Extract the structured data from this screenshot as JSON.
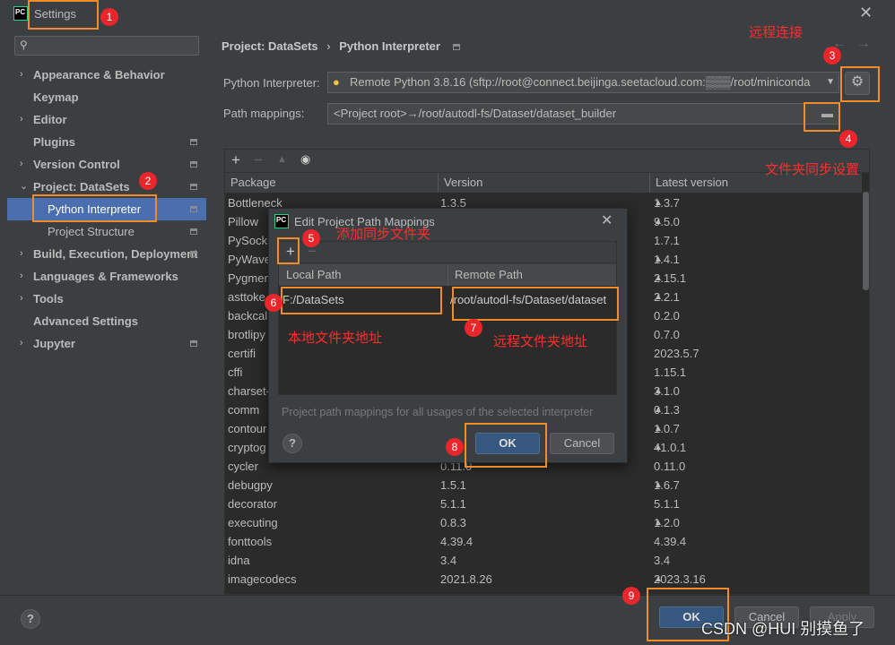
{
  "window": {
    "title": "Settings",
    "logo": "PC"
  },
  "sidebar": {
    "search_placeholder": "",
    "items": [
      {
        "label": "Appearance & Behavior",
        "chevron": "›"
      },
      {
        "label": "Keymap"
      },
      {
        "label": "Editor",
        "chevron": "›"
      },
      {
        "label": "Plugins"
      },
      {
        "label": "Version Control",
        "chevron": "›"
      },
      {
        "label": "Project: DataSets",
        "chevron": "⌄"
      },
      {
        "label": "Python Interpreter"
      },
      {
        "label": "Project Structure"
      },
      {
        "label": "Build, Execution, Deployment",
        "chevron": "›"
      },
      {
        "label": "Languages & Frameworks",
        "chevron": "›"
      },
      {
        "label": "Tools",
        "chevron": "›"
      },
      {
        "label": "Advanced Settings"
      },
      {
        "label": "Jupyter",
        "chevron": "›"
      }
    ]
  },
  "breadcrumb": {
    "parent": "Project: DataSets",
    "sep": "›",
    "current": "Python Interpreter"
  },
  "interpreter": {
    "label": "Python Interpreter:",
    "value": "Remote Python 3.8.16 (sftp://root@connect.beijinga.seetacloud.com:▒▒▒/root/miniconda"
  },
  "mappings": {
    "label": "Path mappings:",
    "value": "<Project root>→/root/autodl-fs/Dataset/dataset_builder"
  },
  "packages": {
    "columns": [
      "Package",
      "Version",
      "Latest version"
    ],
    "rows": [
      [
        "Bottleneck",
        "1.3.5",
        "1.3.7",
        true
      ],
      [
        "Pillow",
        "",
        "9.5.0",
        true
      ],
      [
        "PySocks",
        "",
        "1.7.1",
        false
      ],
      [
        "PyWave",
        "",
        "1.4.1",
        true
      ],
      [
        "Pygmen",
        "",
        "2.15.1",
        true
      ],
      [
        "asttoke",
        "",
        "2.2.1",
        true
      ],
      [
        "backcal",
        "",
        "0.2.0",
        false
      ],
      [
        "brotlipy",
        "",
        "0.7.0",
        false
      ],
      [
        "certifi",
        "",
        "2023.5.7",
        false
      ],
      [
        "cffi",
        "",
        "1.15.1",
        false
      ],
      [
        "charset-",
        "",
        "3.1.0",
        true
      ],
      [
        "comm",
        "",
        "0.1.3",
        true
      ],
      [
        "contour",
        "",
        "1.0.7",
        true
      ],
      [
        "cryptog",
        "",
        "41.0.1",
        true
      ],
      [
        "cycler",
        "0.11.0",
        "0.11.0",
        false
      ],
      [
        "debugpy",
        "1.5.1",
        "1.6.7",
        true
      ],
      [
        "decorator",
        "5.1.1",
        "5.1.1",
        false
      ],
      [
        "executing",
        "0.8.3",
        "1.2.0",
        true
      ],
      [
        "fonttools",
        "4.39.4",
        "4.39.4",
        false
      ],
      [
        "idna",
        "3.4",
        "3.4",
        false
      ],
      [
        "imagecodecs",
        "2021.8.26",
        "2023.3.16",
        true
      ]
    ]
  },
  "dialog": {
    "title": "Edit Project Path Mappings",
    "columns": [
      "Local Path",
      "Remote Path"
    ],
    "local": "F:/DataSets",
    "remote": "/root/autodl-fs/Dataset/dataset",
    "hint": "Project path mappings for all usages of the selected interpreter",
    "ok": "OK",
    "cancel": "Cancel",
    "help": "?"
  },
  "footer": {
    "help": "?",
    "ok": "OK",
    "cancel": "Cancel",
    "apply": "Apply"
  },
  "annotations": {
    "n1": "1",
    "n2": "2",
    "n3": "3",
    "n4": "4",
    "n5": "5",
    "n6": "6",
    "n7": "7",
    "n8": "8",
    "n9": "9",
    "remote_conn": "远程连接",
    "folder_sync": "文件夹同步设置",
    "add_folder": "添加同步文件夹",
    "local_addr": "本地文件夹地址",
    "remote_addr": "远程文件夹地址"
  },
  "watermark": "CSDN @HUI 别摸鱼了",
  "colors": {
    "accent": "#4b6eaf",
    "annotation": "#f28c28",
    "badge": "#e8262b"
  }
}
